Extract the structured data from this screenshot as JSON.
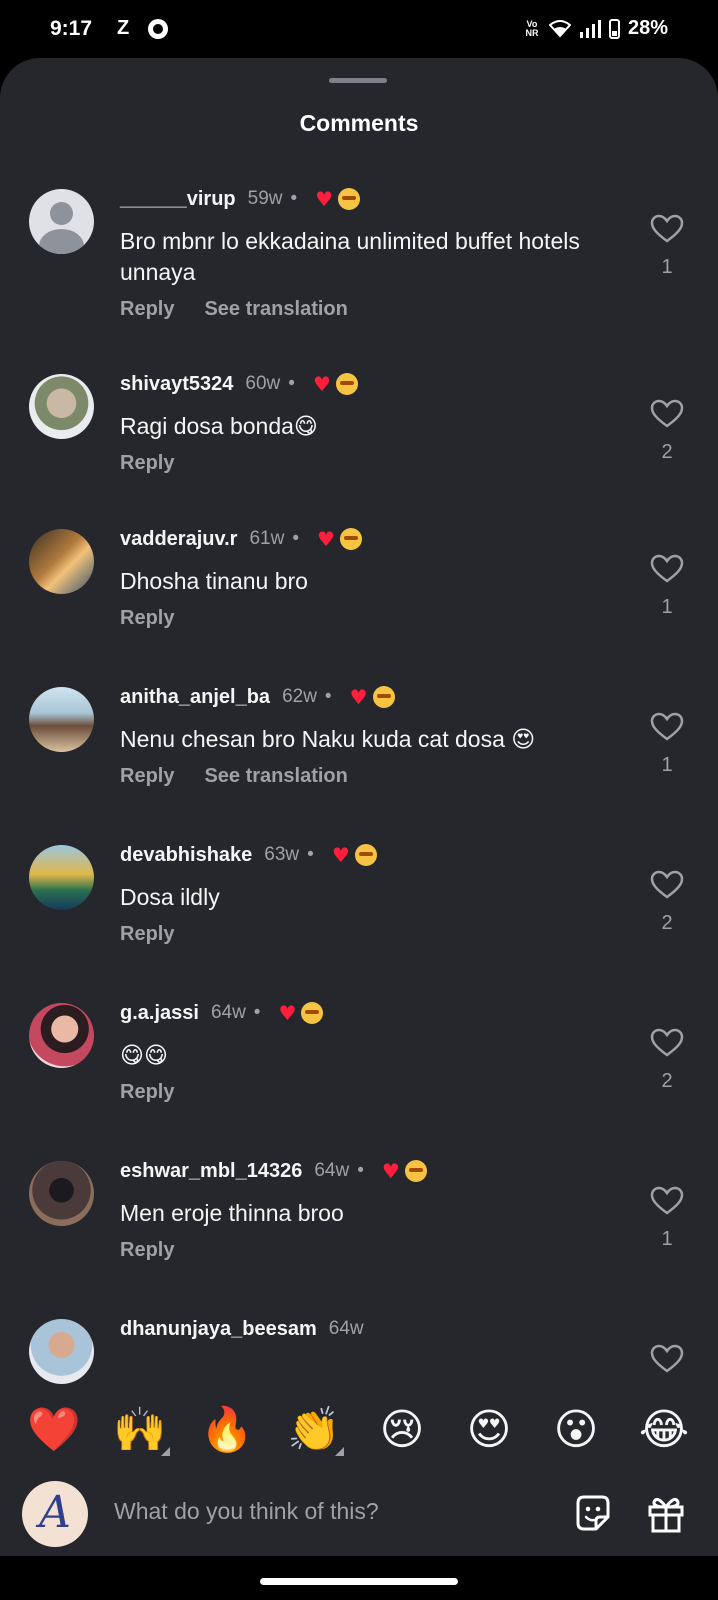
{
  "status_bar": {
    "time": "9:17",
    "carrier_glyph": "Z",
    "volte": "Vo NR",
    "battery": "28%"
  },
  "sheet": {
    "title": "Comments"
  },
  "comments": [
    {
      "username": "______virup",
      "age": "59w",
      "dot": "•",
      "text": "Bro mbnr lo ekkadaina unlimited buffet hotels unnaya",
      "actions": [
        "Reply",
        "See translation"
      ],
      "likes": "1",
      "creator_liked": true
    },
    {
      "username": "shivayt5324",
      "age": "60w",
      "dot": "•",
      "text": "Ragi dosa bonda😋",
      "actions": [
        "Reply"
      ],
      "likes": "2",
      "creator_liked": true
    },
    {
      "username": "vadderajuv.r",
      "age": "61w",
      "dot": "•",
      "text": "Dhosha tinanu bro",
      "actions": [
        "Reply"
      ],
      "likes": "1",
      "creator_liked": true
    },
    {
      "username": "anitha_anjel_ba",
      "age": "62w",
      "dot": "•",
      "text": "Nenu chesan bro Naku kuda cat dosa 😍",
      "actions": [
        "Reply",
        "See translation"
      ],
      "likes": "1",
      "creator_liked": true
    },
    {
      "username": "devabhishake",
      "age": "63w",
      "dot": "•",
      "text": "Dosa ildly",
      "actions": [
        "Reply"
      ],
      "likes": "2",
      "creator_liked": true
    },
    {
      "username": "g.a.jassi",
      "age": "64w",
      "dot": "•",
      "text": "😋😋",
      "actions": [
        "Reply"
      ],
      "likes": "2",
      "creator_liked": true
    },
    {
      "username": "eshwar_mbl_14326",
      "age": "64w",
      "dot": "•",
      "text": "Men eroje thinna broo",
      "actions": [
        "Reply"
      ],
      "likes": "1",
      "creator_liked": true
    },
    {
      "username": "dhanunjaya_beesam",
      "age": "64w",
      "dot": "",
      "text": "",
      "actions": [],
      "likes": "",
      "creator_liked": false
    }
  ],
  "reactions": [
    "❤️",
    "🙌",
    "🔥",
    "👏",
    "😢",
    "😍",
    "😮",
    "😂"
  ],
  "composer": {
    "placeholder": "What do you think of this?",
    "avatar_letter": "A"
  },
  "colors": {
    "sheet_bg": "#25272c",
    "secondary_text": "#9ea1a8",
    "like_red": "#ff1f3d"
  }
}
